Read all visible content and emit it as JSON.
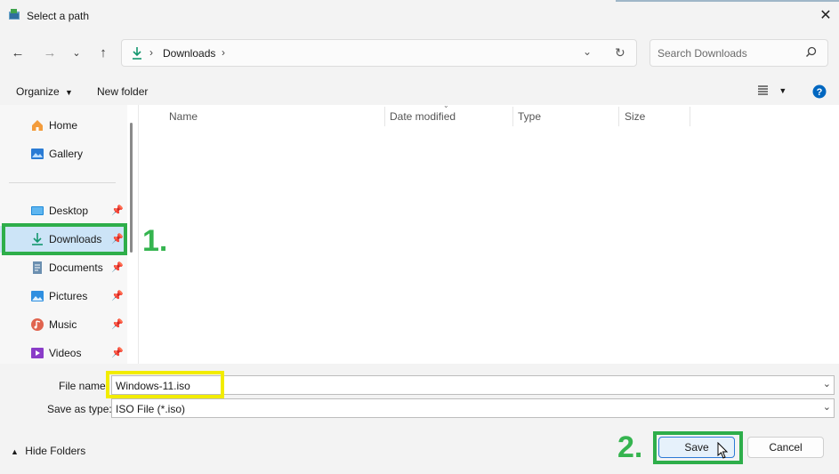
{
  "window": {
    "title": "Select a path"
  },
  "address": {
    "folder": "Downloads"
  },
  "search": {
    "placeholder": "Search Downloads"
  },
  "commandbar": {
    "organize": "Organize",
    "new_folder": "New folder"
  },
  "nav": {
    "items": [
      {
        "label": "Home",
        "pinned": false
      },
      {
        "label": "Gallery",
        "pinned": false
      },
      {
        "label": "Desktop",
        "pinned": true
      },
      {
        "label": "Downloads",
        "pinned": true,
        "selected": true
      },
      {
        "label": "Documents",
        "pinned": true
      },
      {
        "label": "Pictures",
        "pinned": true
      },
      {
        "label": "Music",
        "pinned": true
      },
      {
        "label": "Videos",
        "pinned": true
      }
    ]
  },
  "columns": [
    "Name",
    "Date modified",
    "Type",
    "Size"
  ],
  "form": {
    "file_name_label": "File name:",
    "file_name_value": "Windows-11.iso",
    "save_type_label": "Save as type:",
    "save_type_value": "ISO File (*.iso)"
  },
  "footer": {
    "hide_folders": "Hide Folders",
    "save": "Save",
    "cancel": "Cancel"
  },
  "annotations": {
    "step1": "1.",
    "step2": "2."
  },
  "colors": {
    "highlight_green": "#2eae4a",
    "highlight_yellow": "#f2ec00",
    "selected_bg": "#cce4f7",
    "accent": "#0067c0"
  },
  "icons": [
    "app-icon",
    "close-icon",
    "back-arrow-icon",
    "forward-arrow-icon",
    "recent-chevron-icon",
    "up-arrow-icon",
    "download-icon",
    "chevron-right-icon",
    "chevron-down-icon",
    "refresh-icon",
    "search-icon",
    "organize-dropdown-icon",
    "view-menu-icon",
    "help-icon",
    "home-icon",
    "gallery-icon",
    "desktop-icon",
    "documents-icon",
    "pictures-icon",
    "music-icon",
    "videos-icon",
    "pin-icon",
    "mouse-cursor-icon"
  ]
}
